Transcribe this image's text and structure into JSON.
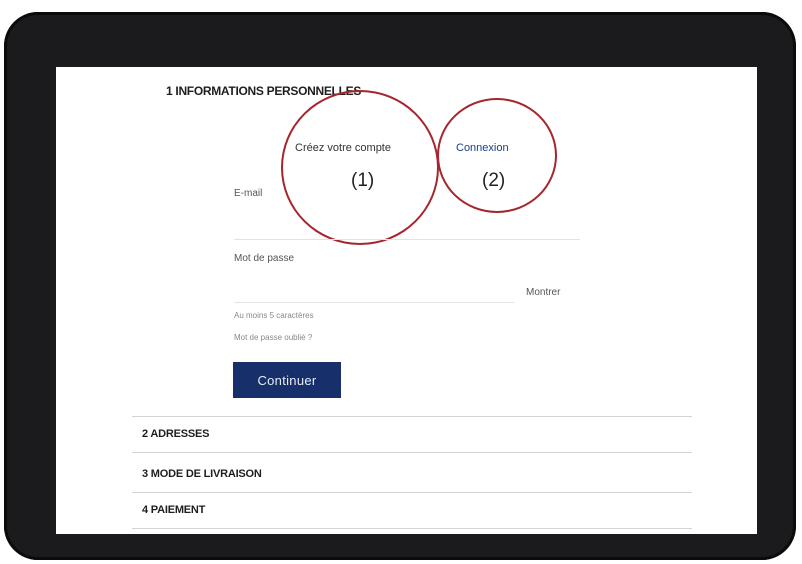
{
  "checkout": {
    "step1_title": "1 INFORMATIONS PERSONNELLES",
    "tabs": {
      "create_account": "Créez votre compte",
      "login": "Connexion"
    },
    "annotations": {
      "one": "(1)",
      "two": "(2)"
    },
    "form": {
      "email_label": "E-mail",
      "email_value": "",
      "password_label": "Mot de passe",
      "password_value": "",
      "show_label": "Montrer",
      "password_hint": "Au moins 5 caractères",
      "forgot_password": "Mot de passe oublié ?",
      "continue_label": "Continuer"
    },
    "steps": [
      {
        "label": "2 ADRESSES"
      },
      {
        "label": "3 MODE DE LIVRAISON"
      },
      {
        "label": "4 PAIEMENT"
      }
    ]
  },
  "colors": {
    "bezel": "#1b1b1d",
    "accent_button": "#17306b",
    "link": "#1a3d8a",
    "annotation_circle": "#a5262d"
  }
}
